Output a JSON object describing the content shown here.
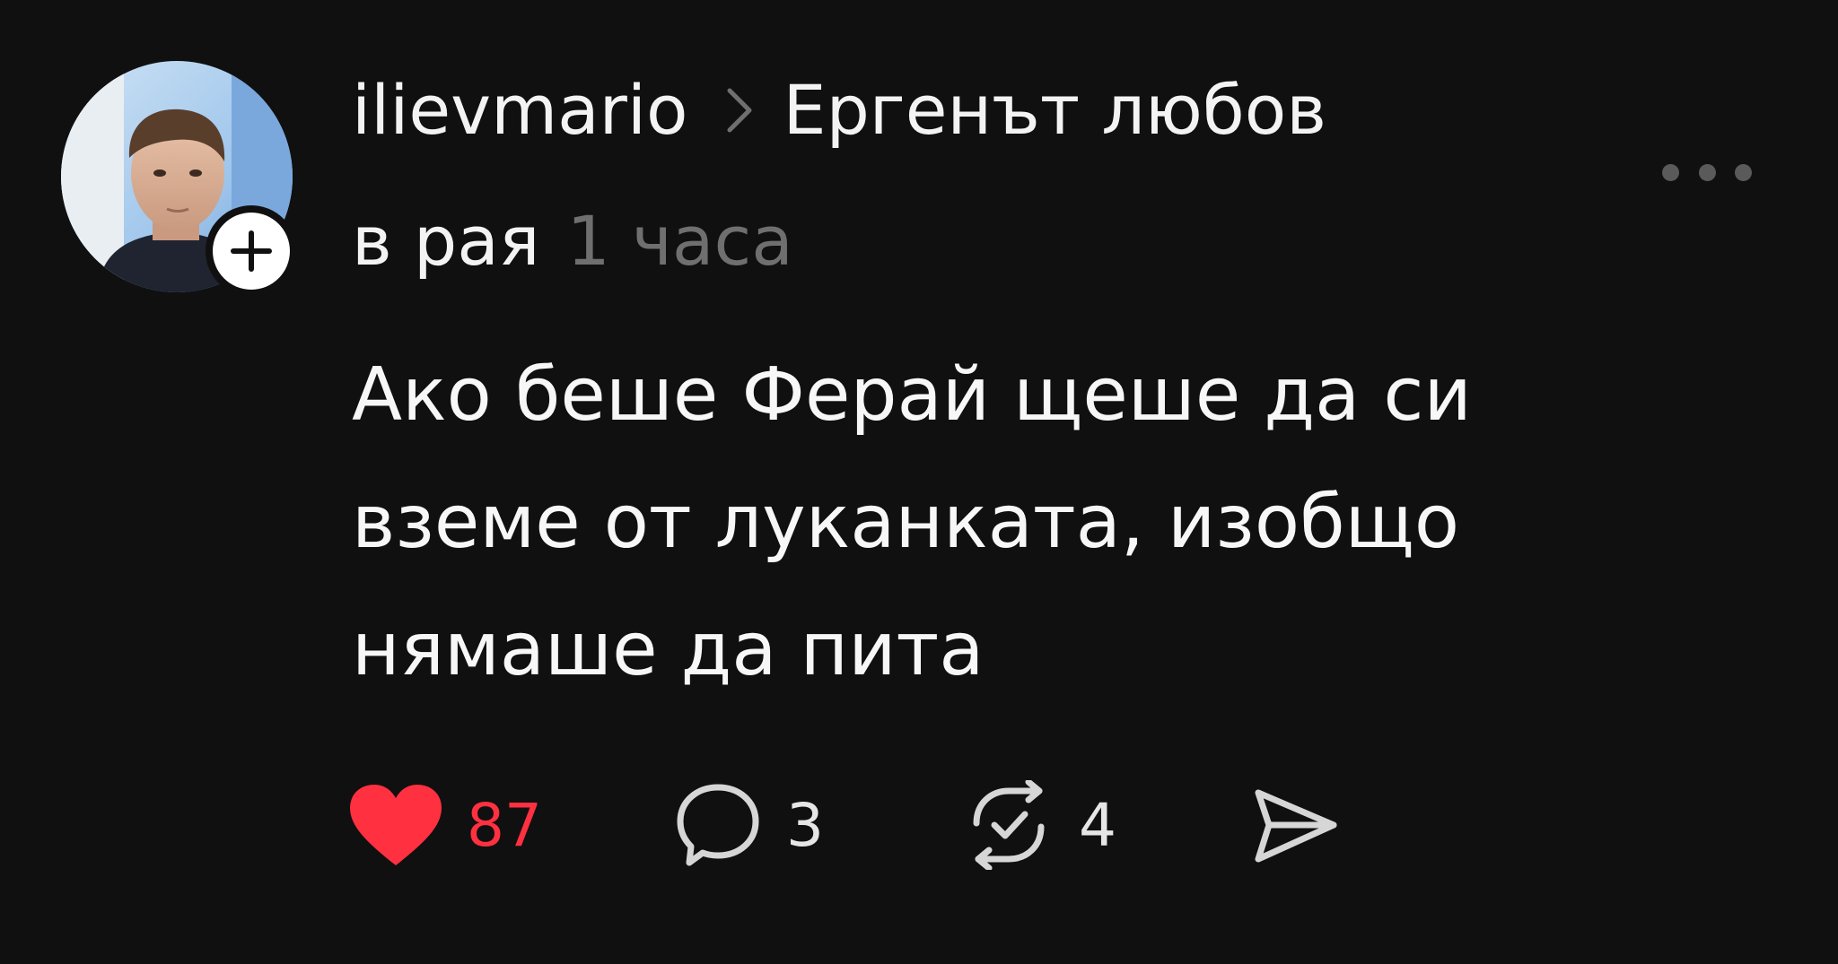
{
  "post": {
    "username": "ilievmario",
    "topic": "Ергенът любов",
    "topic_line2": "в рая",
    "timestamp": "1 часа",
    "text": "Ако беше Ферай щеше да си\nвземе от луканката, изобщо\nнямаше да пита"
  },
  "actions": {
    "likes": "87",
    "comments": "3",
    "reposts": "4"
  },
  "icons": {
    "like": "heart-icon",
    "comment": "comment-bubble-icon",
    "repost": "repost-icon",
    "share": "send-icon",
    "more": "more-icon",
    "follow": "plus-icon",
    "separator": "chevron-right-icon"
  },
  "colors": {
    "background": "#101010",
    "text": "#f3f3f3",
    "muted": "#6f6f6f",
    "like": "#ff3040"
  }
}
